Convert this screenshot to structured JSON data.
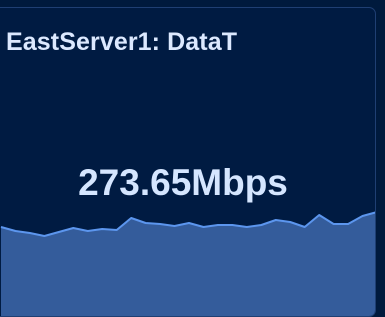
{
  "panel": {
    "title": "EastServer1: DataT",
    "value": "273.65Mbps"
  },
  "colors": {
    "background": "#001b42",
    "title_text": "#dce9ff",
    "value_text": "#d5e6ff",
    "spark_fill": "#345c9b",
    "spark_line": "#5c96ee"
  },
  "chart_data": {
    "type": "area",
    "title": "",
    "xlabel": "",
    "ylabel": "",
    "grid": false,
    "legend": "none",
    "ylim": [
      0,
      100
    ],
    "x": [
      0,
      1,
      2,
      3,
      4,
      5,
      6,
      7,
      8,
      9,
      10,
      11,
      12,
      13,
      14,
      15,
      16,
      17,
      18,
      19,
      20,
      21,
      22,
      23,
      24,
      25,
      26
    ],
    "values": [
      48,
      40,
      36,
      30,
      38,
      46,
      40,
      44,
      42,
      66,
      56,
      54,
      50,
      56,
      48,
      52,
      52,
      48,
      52,
      62,
      58,
      48,
      72,
      54,
      54,
      70,
      78
    ]
  }
}
